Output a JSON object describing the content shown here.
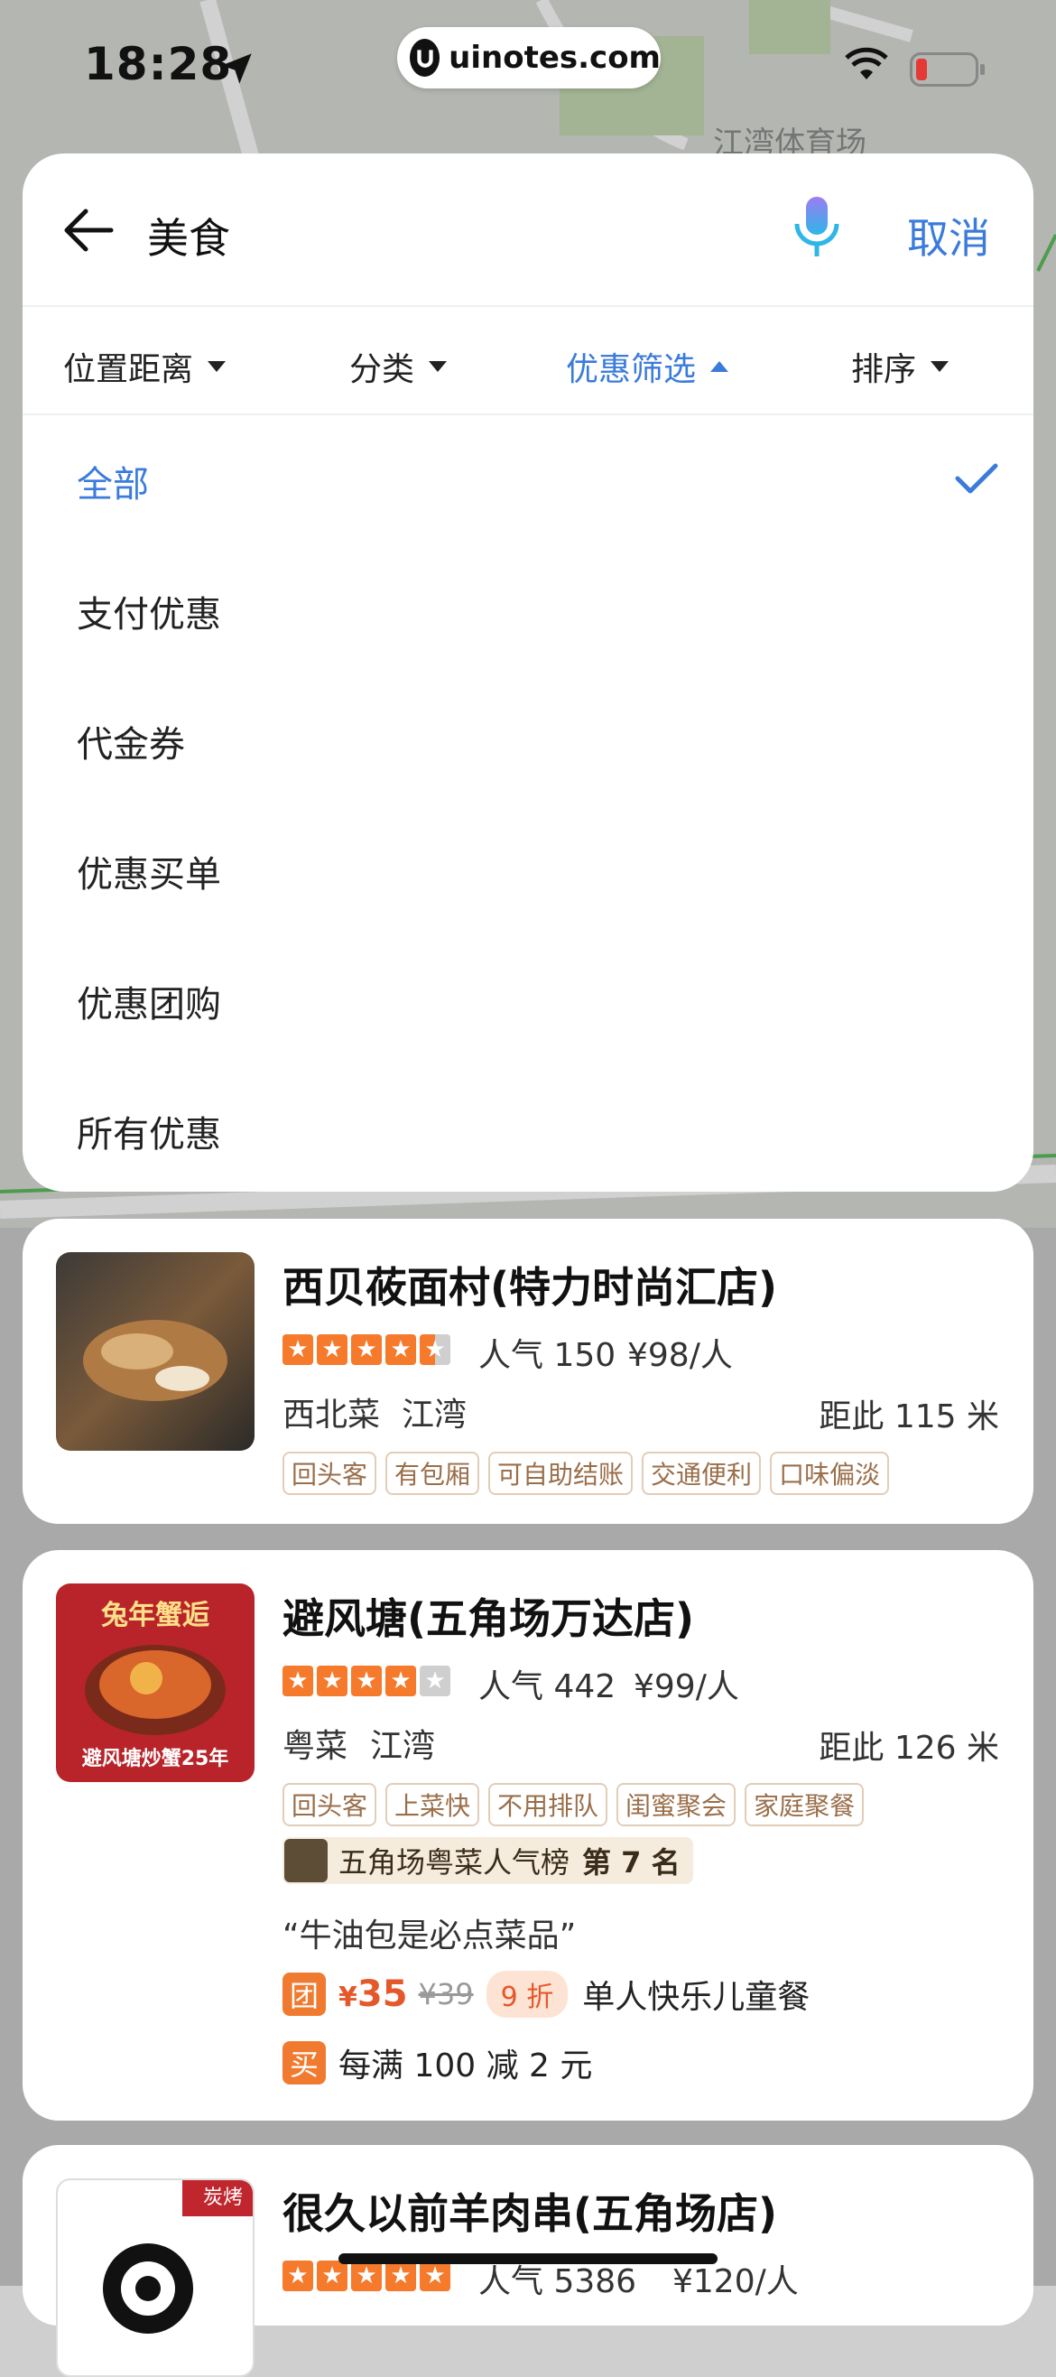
{
  "status": {
    "time": "18:28",
    "url": "uinotes.com"
  },
  "search": {
    "query": "美食",
    "cancel": "取消"
  },
  "filters": [
    {
      "label": "位置距离",
      "active": false
    },
    {
      "label": "分类",
      "active": false
    },
    {
      "label": "优惠筛选",
      "active": true
    },
    {
      "label": "排序",
      "active": false
    }
  ],
  "options": [
    {
      "label": "全部",
      "selected": true
    },
    {
      "label": "支付优惠",
      "selected": false
    },
    {
      "label": "代金券",
      "selected": false
    },
    {
      "label": "优惠买单",
      "selected": false
    },
    {
      "label": "优惠团购",
      "selected": false
    },
    {
      "label": "所有优惠",
      "selected": false
    }
  ],
  "restaurants": [
    {
      "name": "西贝莜面村(特力时尚汇店)",
      "rating": 4.5,
      "popularity": "人气 150",
      "price": "¥98/人",
      "cuisine": "西北菜",
      "area": "江湾",
      "distance": "距此 115 米",
      "tags": [
        "回头客",
        "有包厢",
        "可自助结账",
        "交通便利",
        "口味偏淡"
      ]
    },
    {
      "name": "避风塘(五角场万达店)",
      "rating": 4,
      "popularity": "人气 442",
      "price": "¥99/人",
      "cuisine": "粤菜",
      "area": "江湾",
      "distance": "距此 126 米",
      "tags": [
        "回头客",
        "上菜快",
        "不用排队",
        "闺蜜聚会",
        "家庭聚餐"
      ],
      "rank_text": "五角场粤菜人气榜",
      "rank_pos": "第 7 名",
      "quote": "“牛油包是必点菜品”",
      "deal_badge": "团",
      "deal_price": "35",
      "deal_currency": "¥",
      "deal_old": "¥39",
      "deal_discount": "9 折",
      "deal_name": "单人快乐儿童餐",
      "promo_badge": "买",
      "promo_text": "每满 100 减 2 元",
      "thumb_text_top": "兔年蟹逅",
      "thumb_text_bottom": "避风塘炒蟹25年"
    },
    {
      "name": "很久以前羊肉串(五角场店)",
      "rating": 5,
      "popularity": "人气 5386",
      "price": "¥120/人",
      "corner_tag": "炭烤"
    }
  ],
  "colors": {
    "accent": "#3a7bdb",
    "star": "#f57a2c",
    "deal": "#e5582b"
  }
}
